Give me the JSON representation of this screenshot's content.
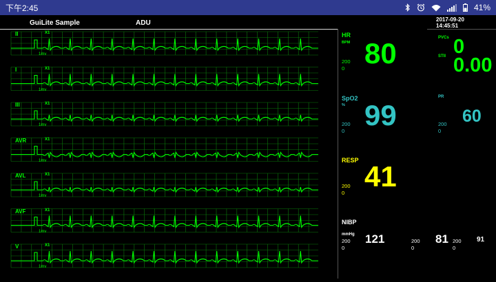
{
  "status_bar": {
    "time": "下午2:45",
    "battery_percent": "41%",
    "icons": [
      "bluetooth-icon",
      "alarm-clock-icon",
      "wifi-icon",
      "cellular-signal-icon",
      "battery-icon"
    ],
    "background_color": "#2f3a8f"
  },
  "header": {
    "title": "GuiLite Sample",
    "mode": "ADU",
    "date": "2017-09-20",
    "time": "14:45:51"
  },
  "ecg": {
    "color": "#00ff00",
    "grid_color": "#0b7a0b",
    "leads": [
      {
        "name": "II",
        "gain": "X1",
        "mv_label": "1mv",
        "morphology": "upright"
      },
      {
        "name": "I",
        "gain": "X1",
        "mv_label": "1mv",
        "morphology": "upright"
      },
      {
        "name": "III",
        "gain": "X1",
        "mv_label": "1mv",
        "morphology": "small"
      },
      {
        "name": "AVR",
        "gain": "X1",
        "mv_label": "1mv",
        "morphology": "inverted"
      },
      {
        "name": "AVL",
        "gain": "X1",
        "mv_label": "1mv",
        "morphology": "flat"
      },
      {
        "name": "AVF",
        "gain": "X1",
        "mv_label": "1mv",
        "morphology": "upright"
      },
      {
        "name": "V",
        "gain": "X1",
        "mv_label": "1mv",
        "morphology": "upright"
      }
    ]
  },
  "params": {
    "hr": {
      "label": "HR",
      "unit": "BPM",
      "high": "200",
      "low": "0",
      "value": "80",
      "color": "#00ff00"
    },
    "pvcs": {
      "label": "PVCs",
      "value": "0",
      "color": "#00ff00"
    },
    "st": {
      "label": "STII",
      "value": "0.00",
      "color": "#00ff00"
    },
    "spo2": {
      "label": "SpO2",
      "unit": "%",
      "high": "200",
      "low": "0",
      "value": "99",
      "color": "#33c4c4"
    },
    "pr": {
      "label": "PR",
      "high": "200",
      "low": "0",
      "value": "60",
      "color": "#33c4c4"
    },
    "resp": {
      "label": "RESP",
      "high": "200",
      "low": "0",
      "value": "41",
      "color": "#ffff00"
    },
    "nibp": {
      "label": "NIBP",
      "unit": "mmHg",
      "sys": {
        "high": "200",
        "low": "0",
        "value": "121"
      },
      "dia": {
        "high": "200",
        "low": "0",
        "value": "81"
      },
      "mean": {
        "high": "200",
        "low": "0",
        "value": "91"
      },
      "color": "#ffffff"
    }
  }
}
